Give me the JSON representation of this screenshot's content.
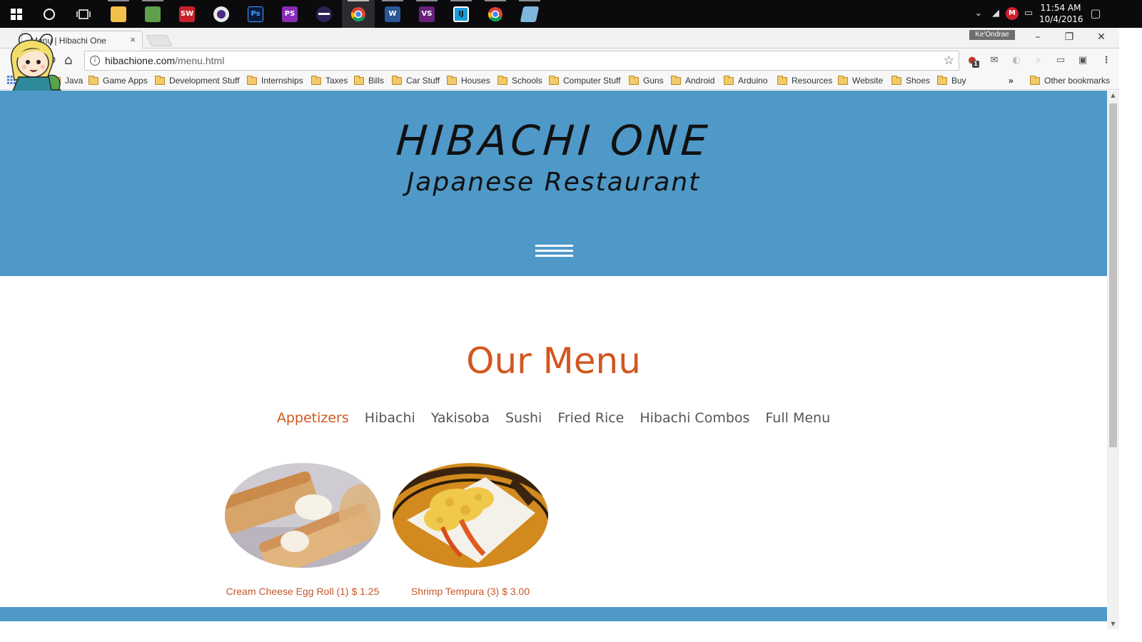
{
  "taskbar": {
    "apps": [
      "windows-start",
      "cortana",
      "task-view",
      "file-explorer",
      "excel",
      "solidworks",
      "fl-studio",
      "photoshop",
      "phpstorm",
      "eclipse",
      "chrome",
      "word",
      "visual-studio",
      "intellij",
      "chrome-alt",
      "notepad"
    ],
    "clock_time": "11:54 AM",
    "clock_date": "10/4/2016"
  },
  "browser": {
    "tab_title": "Menu | Hibachi One",
    "tab_close": "×",
    "profile_name": "Ke'Ondrae",
    "url_host": "hibachione.com",
    "url_path": "/menu.html",
    "bookmarks": [
      "Java",
      "Game Apps",
      "Development Stuff",
      "Internships",
      "Taxes",
      "Bills",
      "Car Stuff",
      "Houses",
      "Schools",
      "Computer Stuff",
      "Guns",
      "Android",
      "Arduino",
      "Resources",
      "Website",
      "Shoes",
      "Buy"
    ],
    "bookmarks_overflow": "»",
    "other_bookmarks": "Other bookmarks",
    "ext_badge": "1"
  },
  "site": {
    "title": "HIBACHI ONE",
    "subtitle": "Japanese Restaurant",
    "menu_heading": "Our Menu",
    "tabs": [
      "Appetizers",
      "Hibachi",
      "Yakisoba",
      "Sushi",
      "Fried Rice",
      "Hibachi Combos",
      "Full Menu"
    ],
    "active_tab": "Appetizers",
    "dishes": [
      {
        "caption": "Cream Cheese Egg Roll (1) $ 1.25"
      },
      {
        "caption": "Shrimp Tempura (3) $ 3.00"
      }
    ]
  },
  "colors": {
    "hero": "#4e99c8",
    "accent": "#d2571f",
    "taskbar": "#0b0b0d"
  }
}
